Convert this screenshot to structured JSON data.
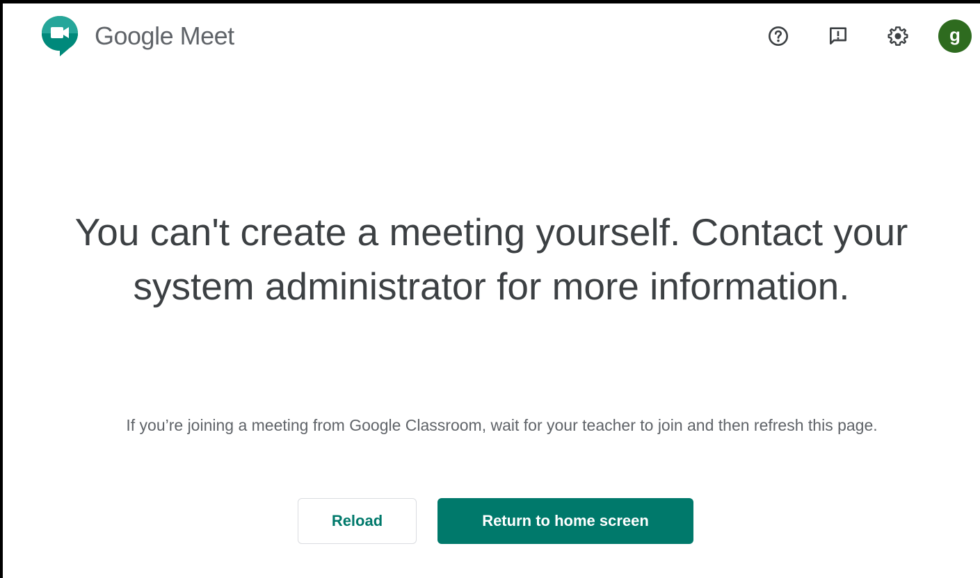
{
  "header": {
    "brand_google": "Google",
    "brand_product": "Meet",
    "icons": [
      "meet-logo-icon",
      "help-icon",
      "feedback-icon",
      "settings-icon"
    ],
    "avatar_initial": "g",
    "avatar_color": "#2e6b1f"
  },
  "main": {
    "headline": "You can't create a meeting yourself. Contact your system administrator for more information.",
    "subtext": "If you’re joining a meeting from Google Classroom, wait for your teacher to join and then refresh this page.",
    "reload_label": "Reload",
    "home_label": "Return to home screen"
  },
  "colors": {
    "accent": "#00796b",
    "text_primary": "#3c4043",
    "text_secondary": "#5f6368"
  }
}
